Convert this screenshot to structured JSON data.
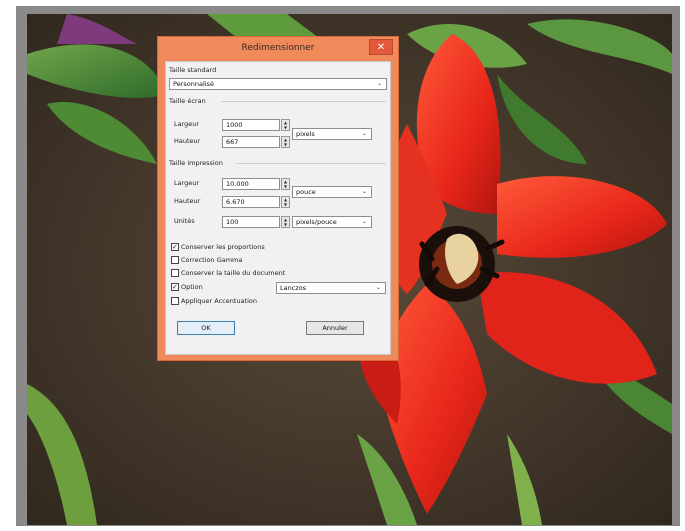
{
  "dialog": {
    "title": "Redimensionner",
    "close_glyph": "✕",
    "standard_size": {
      "label": "Taille standard",
      "value": "Personnalisé"
    },
    "screen_size": {
      "label": "Taille écran",
      "width_label": "Largeur",
      "width_value": "1000",
      "height_label": "Hauteur",
      "height_value": "667",
      "unit": "pixels"
    },
    "print_size": {
      "label": "Taille impression",
      "width_label": "Largeur",
      "width_value": "10.000",
      "height_label": "Hauteur",
      "height_value": "6.670",
      "unit": "pouce",
      "resolution_label": "Unités",
      "resolution_value": "100",
      "resolution_unit": "pixels/pouce"
    },
    "options": {
      "keep_proportions": {
        "label": "Conserver les proportions",
        "checked": true
      },
      "gamma_correction": {
        "label": "Correction Gamma",
        "checked": false
      },
      "keep_document_size": {
        "label": "Conserver la taille du document",
        "checked": false
      },
      "resample": {
        "label": "Option",
        "checked": true,
        "value": "Lanczos"
      },
      "sharpen": {
        "label": "Appliquer Accentuation",
        "checked": false
      }
    },
    "buttons": {
      "ok": "OK",
      "cancel": "Annuler"
    }
  },
  "colors": {
    "dialog_frame": "#f08a5b",
    "close_button": "#e2593b",
    "panel_background": "#f1f1f1"
  },
  "icons": {
    "spin_up": "▲",
    "spin_down": "▼",
    "dropdown": "⌄",
    "check": "✓"
  }
}
